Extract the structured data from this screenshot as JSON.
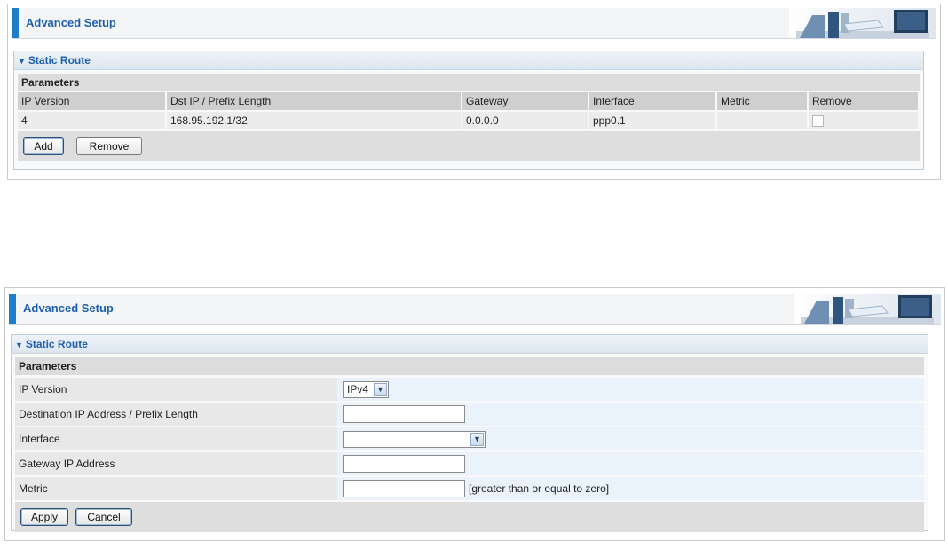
{
  "top_panel": {
    "banner_title": "Advanced Setup",
    "section_title": "Static Route",
    "params_title": "Parameters",
    "columns": [
      "IP Version",
      "Dst IP / Prefix Length",
      "Gateway",
      "Interface",
      "Metric",
      "Remove"
    ],
    "rows": [
      {
        "ip_version": "4",
        "dst": "168.95.192.1/32",
        "gateway": "0.0.0.0",
        "interface": "ppp0.1",
        "metric": "",
        "remove_checked": false
      }
    ],
    "add_label": "Add",
    "remove_label": "Remove"
  },
  "bottom_panel": {
    "banner_title": "Advanced Setup",
    "section_title": "Static Route",
    "params_title": "Parameters",
    "fields": {
      "ip_version_label": "IP Version",
      "ip_version_value": "IPv4",
      "dest_label": "Destination IP Address / Prefix Length",
      "dest_value": "",
      "interface_label": "Interface",
      "interface_value": "",
      "gateway_label": "Gateway IP Address",
      "gateway_value": "",
      "metric_label": "Metric",
      "metric_value": "",
      "metric_hint": "[greater than or equal to zero]"
    },
    "apply_label": "Apply",
    "cancel_label": "Cancel"
  },
  "colors": {
    "accent": "#1f7ec9",
    "title_text": "#1c5fae",
    "section_border": "#b9cde0",
    "value_cell": "#eaf2fb"
  },
  "icons": {
    "section_toggle": "triangle-down-icon",
    "select_arrow": "chevron-down-icon",
    "banner_art": "office-desk-illustration"
  }
}
